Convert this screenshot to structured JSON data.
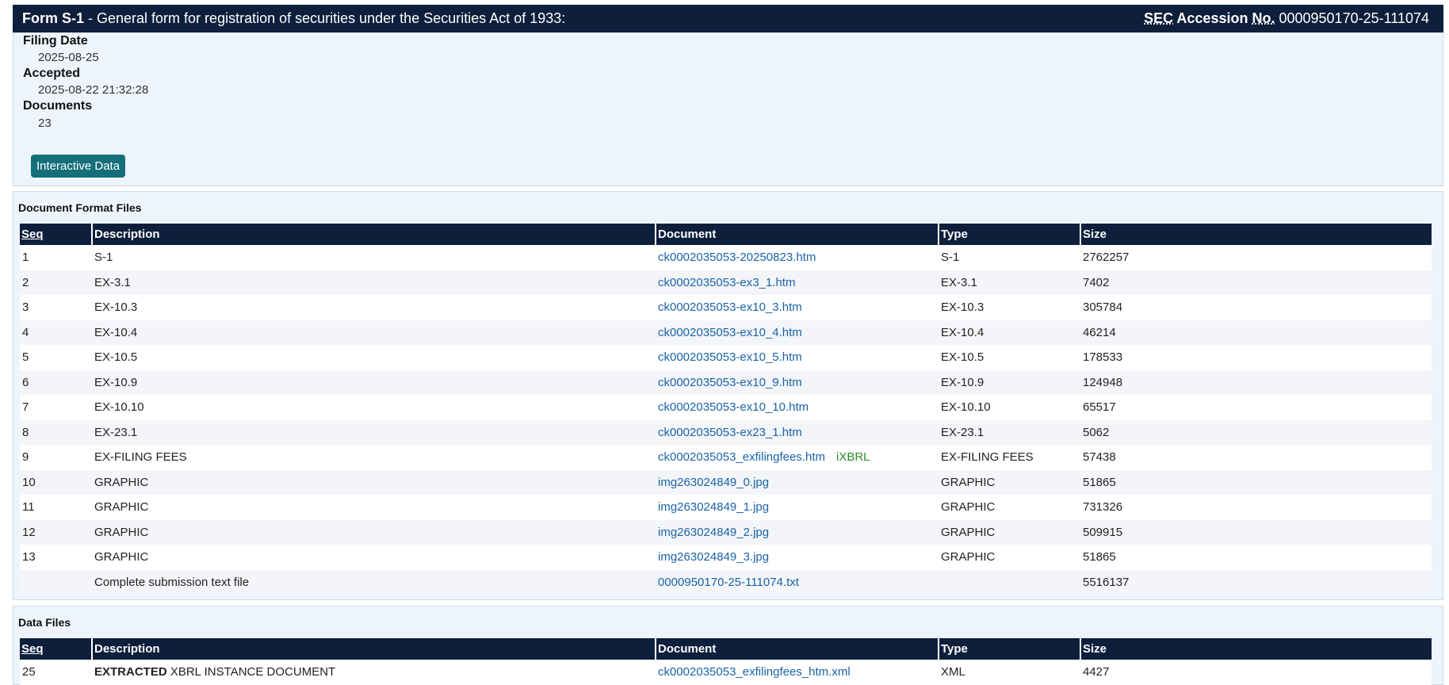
{
  "header": {
    "form_label": "Form S-1",
    "form_desc": " - General form for registration of securities under the Securities Act of 1933:",
    "sec_label": "SEC",
    "accession_label": " Accession ",
    "no_label": "No.",
    "accession_number": "0000950170-25-111074"
  },
  "info": {
    "filing_date_label": "Filing Date",
    "filing_date": "2025-08-25",
    "accepted_label": "Accepted",
    "accepted": "2025-08-22 21:32:28",
    "documents_label": "Documents",
    "documents": "23",
    "interactive_button": "Interactive Data"
  },
  "format_files": {
    "title": "Document Format Files",
    "columns": [
      "Seq",
      "Description",
      "Document",
      "Type",
      "Size"
    ],
    "rows": [
      {
        "seq": "1",
        "desc": "S-1",
        "doc": "ck0002035053-20250823.htm",
        "tag": "",
        "type": "S-1",
        "size": "2762257"
      },
      {
        "seq": "2",
        "desc": "EX-3.1",
        "doc": "ck0002035053-ex3_1.htm",
        "tag": "",
        "type": "EX-3.1",
        "size": "7402"
      },
      {
        "seq": "3",
        "desc": "EX-10.3",
        "doc": "ck0002035053-ex10_3.htm",
        "tag": "",
        "type": "EX-10.3",
        "size": "305784"
      },
      {
        "seq": "4",
        "desc": "EX-10.4",
        "doc": "ck0002035053-ex10_4.htm",
        "tag": "",
        "type": "EX-10.4",
        "size": "46214"
      },
      {
        "seq": "5",
        "desc": "EX-10.5",
        "doc": "ck0002035053-ex10_5.htm",
        "tag": "",
        "type": "EX-10.5",
        "size": "178533"
      },
      {
        "seq": "6",
        "desc": "EX-10.9",
        "doc": "ck0002035053-ex10_9.htm",
        "tag": "",
        "type": "EX-10.9",
        "size": "124948"
      },
      {
        "seq": "7",
        "desc": "EX-10.10",
        "doc": "ck0002035053-ex10_10.htm",
        "tag": "",
        "type": "EX-10.10",
        "size": "65517"
      },
      {
        "seq": "8",
        "desc": "EX-23.1",
        "doc": "ck0002035053-ex23_1.htm",
        "tag": "",
        "type": "EX-23.1",
        "size": "5062"
      },
      {
        "seq": "9",
        "desc": "EX-FILING FEES",
        "doc": "ck0002035053_exfilingfees.htm",
        "tag": "iXBRL",
        "type": "EX-FILING FEES",
        "size": "57438"
      },
      {
        "seq": "10",
        "desc": "GRAPHIC",
        "doc": "img263024849_0.jpg",
        "tag": "",
        "type": "GRAPHIC",
        "size": "51865"
      },
      {
        "seq": "11",
        "desc": "GRAPHIC",
        "doc": "img263024849_1.jpg",
        "tag": "",
        "type": "GRAPHIC",
        "size": "731326"
      },
      {
        "seq": "12",
        "desc": "GRAPHIC",
        "doc": "img263024849_2.jpg",
        "tag": "",
        "type": "GRAPHIC",
        "size": "509915"
      },
      {
        "seq": "13",
        "desc": "GRAPHIC",
        "doc": "img263024849_3.jpg",
        "tag": "",
        "type": "GRAPHIC",
        "size": "51865"
      },
      {
        "seq": "",
        "desc": "Complete submission text file",
        "doc": "0000950170-25-111074.txt",
        "tag": "",
        "type": "",
        "size": "5516137"
      }
    ]
  },
  "data_files": {
    "title": "Data Files",
    "columns": [
      "Seq",
      "Description",
      "Document",
      "Type",
      "Size"
    ],
    "rows": [
      {
        "seq": "25",
        "desc_bold": "EXTRACTED",
        "desc": " XBRL INSTANCE DOCUMENT",
        "doc": "ck0002035053_exfilingfees_htm.xml",
        "type": "XML",
        "size": "4427"
      }
    ]
  }
}
